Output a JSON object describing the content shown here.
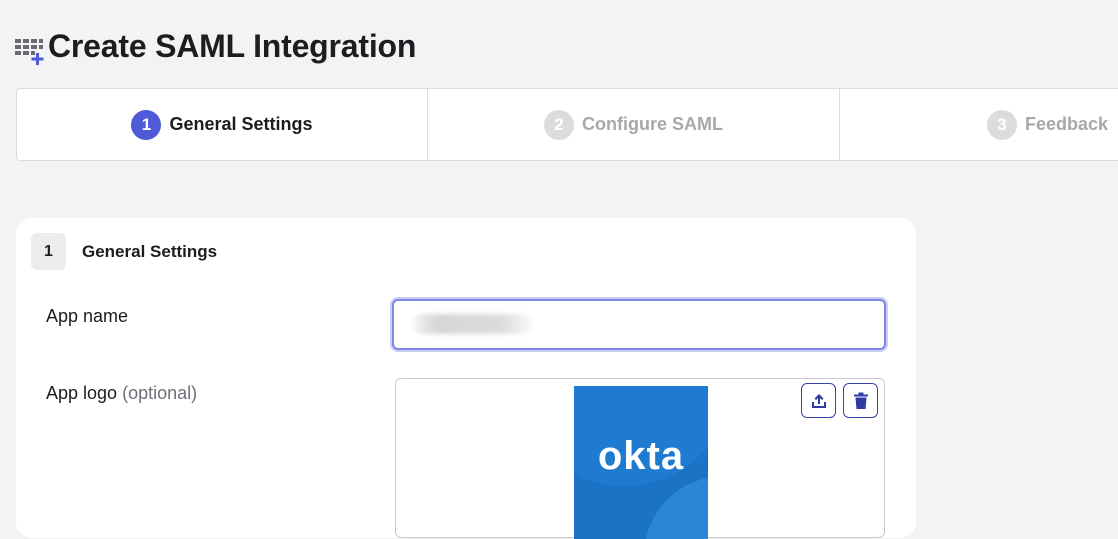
{
  "header": {
    "title": "Create SAML Integration",
    "icon": "app-grid-add-icon"
  },
  "wizard": {
    "steps": [
      {
        "number": "1",
        "label": "General Settings",
        "state": "active"
      },
      {
        "number": "2",
        "label": "Configure SAML",
        "state": "inactive"
      },
      {
        "number": "3",
        "label": "Feedback",
        "state": "inactive"
      }
    ]
  },
  "section": {
    "number": "1",
    "title": "General Settings"
  },
  "fields": {
    "app_name": {
      "label": "App name",
      "value": ""
    },
    "app_logo": {
      "label": "App logo",
      "optional_label": "(optional)",
      "logo_text": "okta",
      "upload_icon": "upload-icon",
      "delete_icon": "trash-icon"
    }
  },
  "colors": {
    "accent": "#4f5ad7",
    "okta_blue": "#1b73c6",
    "background": "#f3f3f3"
  }
}
